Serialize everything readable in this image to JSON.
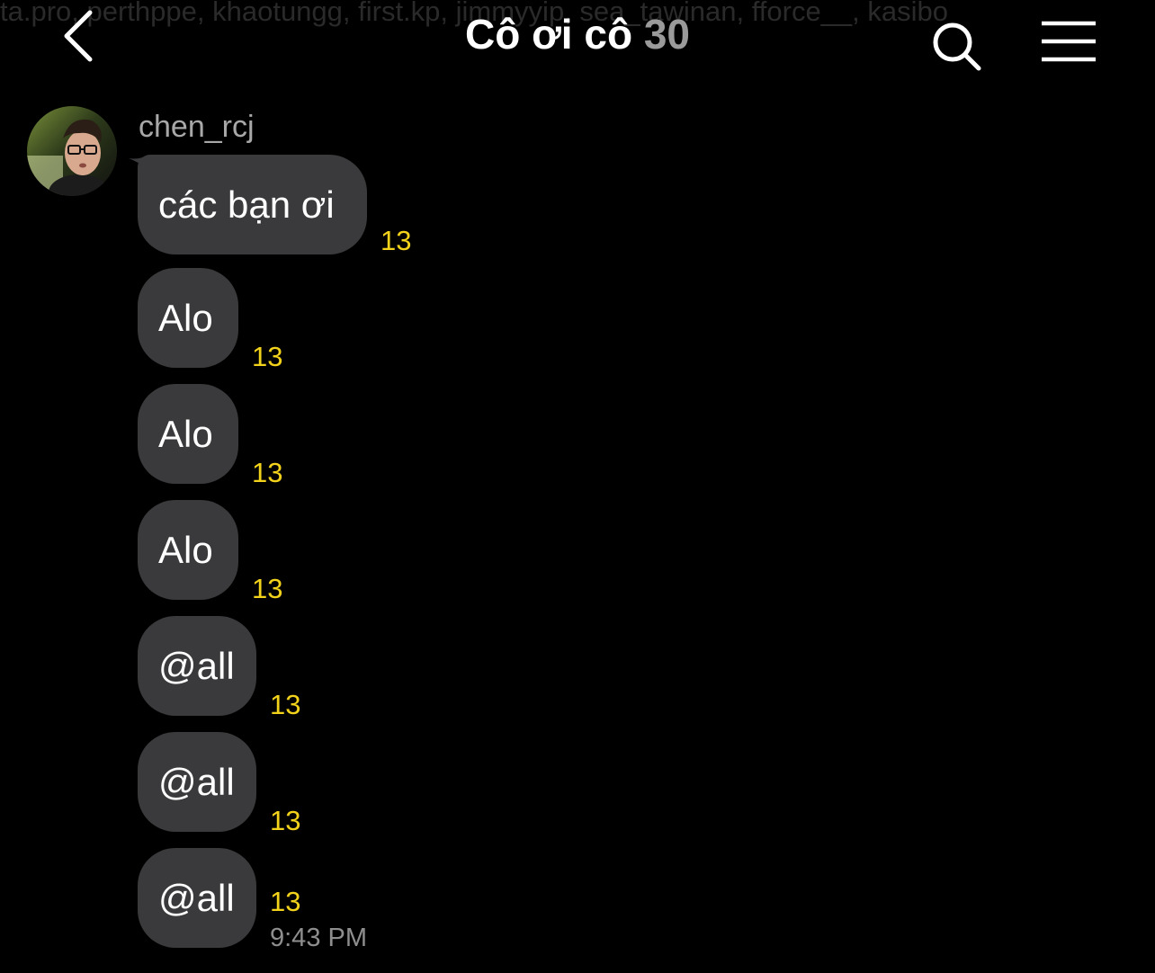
{
  "header": {
    "members_preview": "ta.pro, perthppe, khaotungg, first.kp, jimmyyip, sea_tawinan, fforce__, kasibo",
    "title": "Cô ơi cô",
    "member_count": "30",
    "back_icon": "chevron-left-icon",
    "search_icon": "search-icon",
    "menu_icon": "hamburger-menu-icon"
  },
  "chat": {
    "sender": "chen_rcj",
    "messages": [
      {
        "text": "các bạn ơi",
        "read_count": "13"
      },
      {
        "text": "Alo",
        "read_count": "13"
      },
      {
        "text": "Alo",
        "read_count": "13"
      },
      {
        "text": "Alo",
        "read_count": "13"
      },
      {
        "text": "@all",
        "read_count": "13"
      },
      {
        "text": "@all",
        "read_count": "13"
      },
      {
        "text": "@all",
        "read_count": "13"
      }
    ],
    "last_time": "9:43 PM"
  },
  "colors": {
    "background": "#000000",
    "bubble": "#3a3a3c",
    "read_count": "#f2d21b",
    "muted_text": "#a8a8a8"
  }
}
